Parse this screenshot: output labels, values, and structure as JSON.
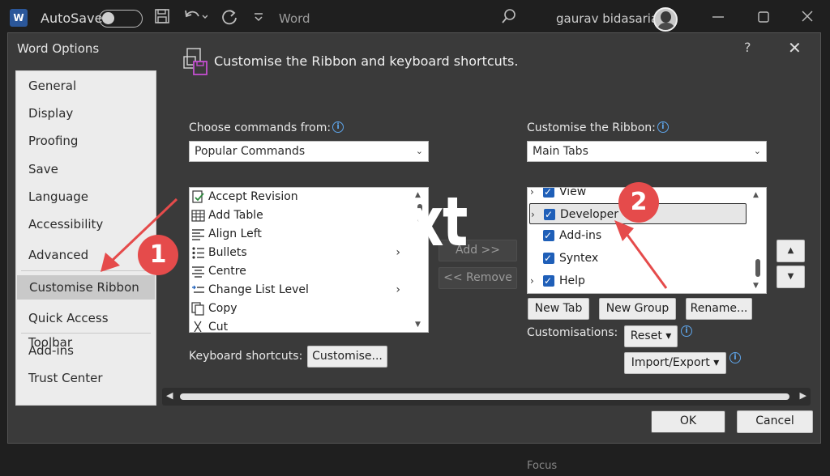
{
  "wordbar": {
    "logo": "W",
    "autosave_label": "AutoSave",
    "app_name": "Word",
    "user_name": "gaurav bidasaria"
  },
  "dialog": {
    "title": "Word Options",
    "help": "?",
    "close": "✕"
  },
  "nav": {
    "items": [
      {
        "label": "General"
      },
      {
        "label": "Display"
      },
      {
        "label": "Proofing"
      },
      {
        "label": "Save"
      },
      {
        "label": "Language"
      },
      {
        "label": "Accessibility"
      },
      {
        "label": "Advanced"
      },
      {
        "label": "Customise Ribbon"
      },
      {
        "label": "Quick Access Toolbar"
      },
      {
        "label": "Add-ins"
      },
      {
        "label": "Trust Center"
      }
    ],
    "selected": "Customise Ribbon"
  },
  "header": {
    "title": "Customise the Ribbon and keyboard shortcuts."
  },
  "left": {
    "choose_label": "Choose commands from:",
    "choose_value": "Popular Commands",
    "commands": [
      {
        "icon": "accept-revision-icon",
        "label": "Accept Revision"
      },
      {
        "icon": "table-icon",
        "label": "Add Table"
      },
      {
        "icon": "align-left-icon",
        "label": "Align Left"
      },
      {
        "icon": "bullets-icon",
        "label": "Bullets"
      },
      {
        "icon": "align-center-icon",
        "label": "Centre"
      },
      {
        "icon": "change-list-level-icon",
        "label": "Change List Level"
      },
      {
        "icon": "copy-icon",
        "label": "Copy"
      },
      {
        "icon": "cut-icon",
        "label": "Cut"
      }
    ],
    "keyboard_label": "Keyboard shortcuts:",
    "customise_button": "Customise..."
  },
  "middle": {
    "add_button": "Add >>",
    "remove_button": "<< Remove"
  },
  "right": {
    "ribbon_label": "Customise the Ribbon:",
    "ribbon_value": "Main Tabs",
    "tabs": [
      {
        "label": "View",
        "checked": true
      },
      {
        "label": "Developer",
        "checked": true
      },
      {
        "label": "Add-ins",
        "checked": true
      },
      {
        "label": "Syntex",
        "checked": true
      },
      {
        "label": "Help",
        "checked": true
      }
    ],
    "new_tab_button": "New Tab",
    "new_group_button": "New Group",
    "rename_button": "Rename...",
    "customisations_label": "Customisations:",
    "reset_button": "Reset ▾",
    "import_export_button": "Import/Export ▾"
  },
  "footer": {
    "ok_button": "OK",
    "cancel_button": "Cancel"
  },
  "overlay": {
    "big_text": "Text",
    "badge_1": "1",
    "badge_2": "2",
    "annotation_color": "#e54b4b"
  },
  "statusbar": {
    "focus_label": "Focus"
  }
}
